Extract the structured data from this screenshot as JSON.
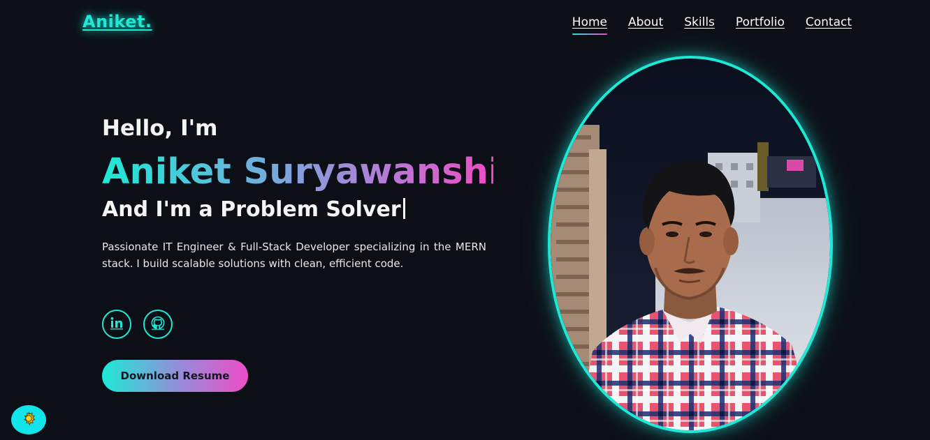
{
  "header": {
    "logo": "Aniket.",
    "nav": [
      {
        "label": "Home",
        "active": true
      },
      {
        "label": "About",
        "active": false
      },
      {
        "label": "Skills",
        "active": false
      },
      {
        "label": "Portfolio",
        "active": false
      },
      {
        "label": "Contact",
        "active": false
      }
    ]
  },
  "hero": {
    "greeting": "Hello, I'm",
    "name": "Aniket Suryawanshi",
    "role": "And I'm a Problem Solver",
    "description": "Passionate IT Engineer & Full-Stack Developer specializing in the MERN stack. I build scalable solutions with clean, efficient code.",
    "socials": [
      {
        "icon": "linkedin-icon"
      },
      {
        "icon": "github-icon"
      }
    ],
    "resume_label": "Download Resume"
  },
  "theme_toggle": {
    "icon": "sun-icon"
  },
  "colors": {
    "background": "#0d0f17",
    "accent": "#1de9d6",
    "accent_pink": "#e94cc8"
  }
}
